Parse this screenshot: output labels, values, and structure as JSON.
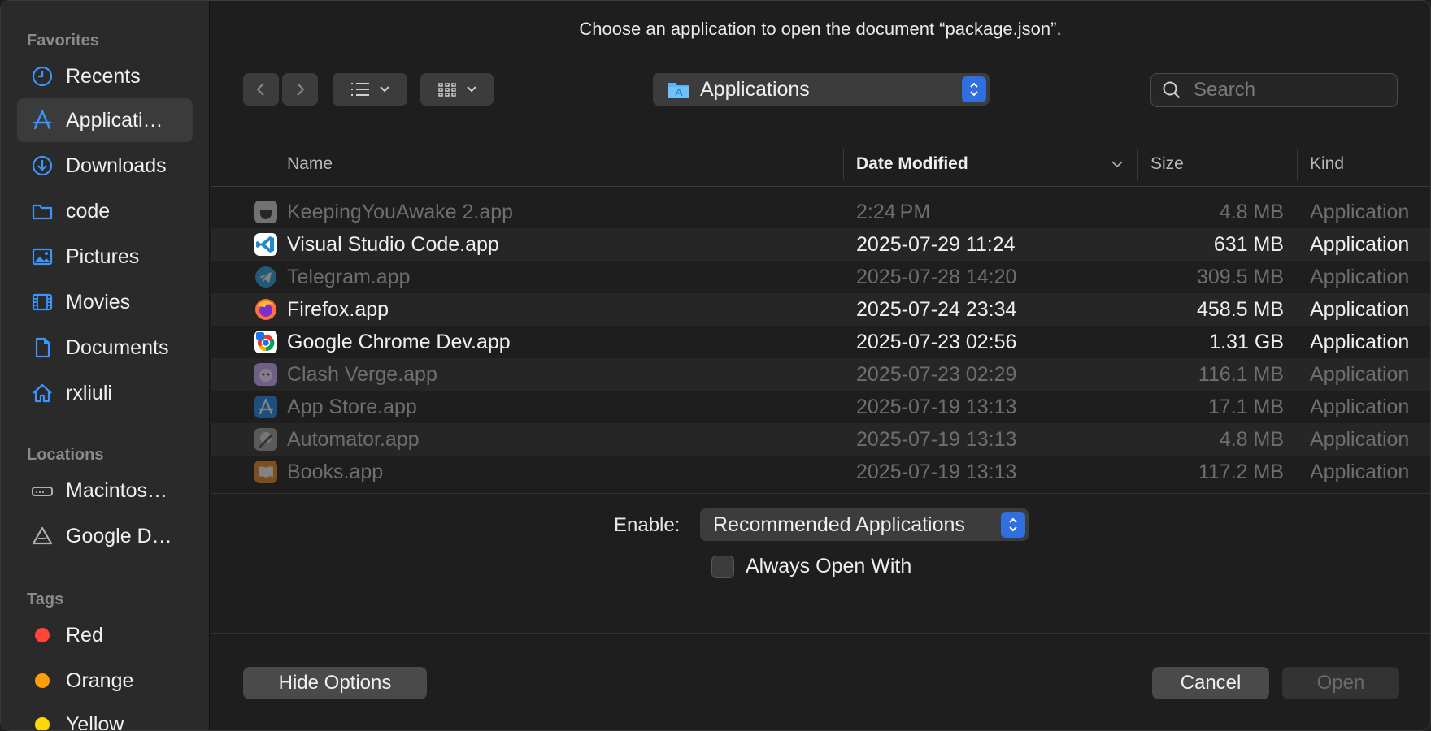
{
  "dialog": {
    "title": "Choose an application to open the document “package.json”."
  },
  "sidebar": {
    "favorites_heading": "Favorites",
    "favorites": [
      {
        "label": "Recents",
        "icon": "clock-icon",
        "selected": false
      },
      {
        "label": "Applicati…",
        "icon": "applications-icon",
        "selected": true
      },
      {
        "label": "Downloads",
        "icon": "download-icon",
        "selected": false
      },
      {
        "label": "code",
        "icon": "folder-icon",
        "selected": false
      },
      {
        "label": "Pictures",
        "icon": "pictures-icon",
        "selected": false
      },
      {
        "label": "Movies",
        "icon": "film-icon",
        "selected": false
      },
      {
        "label": "Documents",
        "icon": "document-icon",
        "selected": false
      },
      {
        "label": "rxliuli",
        "icon": "home-icon",
        "selected": false
      }
    ],
    "locations_heading": "Locations",
    "locations": [
      {
        "label": "Macintos…",
        "icon": "disk-icon"
      },
      {
        "label": "Google D…",
        "icon": "google-drive-icon"
      }
    ],
    "tags_heading": "Tags",
    "tags": [
      {
        "label": "Red",
        "color": "#ff453a"
      },
      {
        "label": "Orange",
        "color": "#ff9f0a"
      },
      {
        "label": "Yellow",
        "color": "#ffd60a"
      }
    ]
  },
  "toolbar": {
    "path_label": "Applications",
    "search_placeholder": "Search"
  },
  "columns": {
    "name": "Name",
    "date": "Date Modified",
    "size": "Size",
    "kind": "Kind"
  },
  "files": [
    {
      "name": "KeepingYouAwake 2.app",
      "date": "2:24 PM",
      "size": "4.8 MB",
      "kind": "Application",
      "enabled": false,
      "icon": "keepingyouawake-icon"
    },
    {
      "name": "Visual Studio Code.app",
      "date": "2025-07-29 11:24",
      "size": "631 MB",
      "kind": "Application",
      "enabled": true,
      "icon": "vscode-icon"
    },
    {
      "name": "Telegram.app",
      "date": "2025-07-28 14:20",
      "size": "309.5 MB",
      "kind": "Application",
      "enabled": false,
      "icon": "telegram-icon"
    },
    {
      "name": "Firefox.app",
      "date": "2025-07-24 23:34",
      "size": "458.5 MB",
      "kind": "Application",
      "enabled": true,
      "icon": "firefox-icon"
    },
    {
      "name": "Google Chrome Dev.app",
      "date": "2025-07-23 02:56",
      "size": "1.31 GB",
      "kind": "Application",
      "enabled": true,
      "icon": "chrome-dev-icon"
    },
    {
      "name": "Clash Verge.app",
      "date": "2025-07-23 02:29",
      "size": "116.1 MB",
      "kind": "Application",
      "enabled": false,
      "icon": "clash-verge-icon"
    },
    {
      "name": "App Store.app",
      "date": "2025-07-19 13:13",
      "size": "17.1 MB",
      "kind": "Application",
      "enabled": false,
      "icon": "app-store-icon"
    },
    {
      "name": "Automator.app",
      "date": "2025-07-19 13:13",
      "size": "4.8 MB",
      "kind": "Application",
      "enabled": false,
      "icon": "automator-icon"
    },
    {
      "name": "Books.app",
      "date": "2025-07-19 13:13",
      "size": "117.2 MB",
      "kind": "Application",
      "enabled": false,
      "icon": "books-icon"
    }
  ],
  "options": {
    "enable_label": "Enable:",
    "enable_value": "Recommended Applications",
    "always_open_label": "Always Open With",
    "always_open_checked": false
  },
  "buttons": {
    "hide_options": "Hide Options",
    "cancel": "Cancel",
    "open": "Open"
  },
  "colors": {
    "accent": "#2f6fe0",
    "sidebar_icon": "#3a95ff"
  }
}
